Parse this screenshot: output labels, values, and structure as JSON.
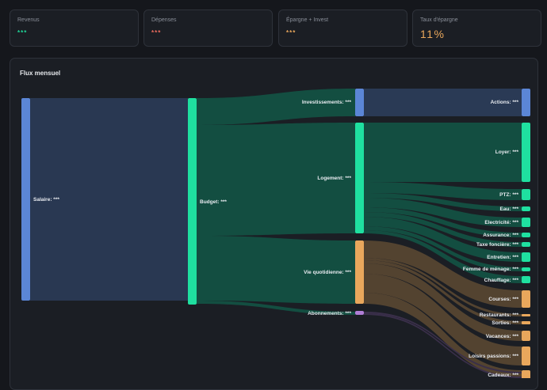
{
  "kpis": [
    {
      "label": "Revenus",
      "value": "***",
      "color": "#1fd99a"
    },
    {
      "label": "Dépenses",
      "value": "***",
      "color": "#ec6b5e"
    },
    {
      "label": "Épargne + Invest",
      "value": "***",
      "color": "#e9a75c"
    },
    {
      "label": "Taux d'épargne",
      "value": "11%",
      "color": "#e9a75c"
    }
  ],
  "flux": {
    "title": "Flux mensuel",
    "nodes": [
      {
        "label": "Salaire: ***",
        "color": "#5b86d6"
      },
      {
        "label": "Budget: ***",
        "color": "#1fe0a0"
      },
      {
        "label": "Investissements: ***",
        "color": "#5b86d6"
      },
      {
        "label": "Logement: ***",
        "color": "#1fe0a0"
      },
      {
        "label": "Vie quotidienne: ***",
        "color": "#e9a75c"
      },
      {
        "label": "Abonnements: ***",
        "color": "#b07ed6"
      },
      {
        "label": "Actions: ***",
        "color": "#5b86d6"
      },
      {
        "label": "Loyer: ***",
        "color": "#1fe0a0"
      },
      {
        "label": "PTZ: ***",
        "color": "#1fe0a0"
      },
      {
        "label": "Eau: ***",
        "color": "#1fe0a0"
      },
      {
        "label": "Electricité: ***",
        "color": "#1fe0a0"
      },
      {
        "label": "Assurance: ***",
        "color": "#1fe0a0"
      },
      {
        "label": "Taxe foncière: ***",
        "color": "#1fe0a0"
      },
      {
        "label": "Entretien: ***",
        "color": "#1fe0a0"
      },
      {
        "label": "Femme de ménage: ***",
        "color": "#1fe0a0"
      },
      {
        "label": "Chauffage: ***",
        "color": "#1fe0a0"
      },
      {
        "label": "Courses: ***",
        "color": "#e9a75c"
      },
      {
        "label": "Restaurants: ***",
        "color": "#e9a75c"
      },
      {
        "label": "Sorties: ***",
        "color": "#e9a75c"
      },
      {
        "label": "Vacances: ***",
        "color": "#e9a75c"
      },
      {
        "label": "Loisirs passions: ***",
        "color": "#e9a75c"
      },
      {
        "label": "Cadeaux: ***",
        "color": "#e9a75c"
      }
    ]
  }
}
